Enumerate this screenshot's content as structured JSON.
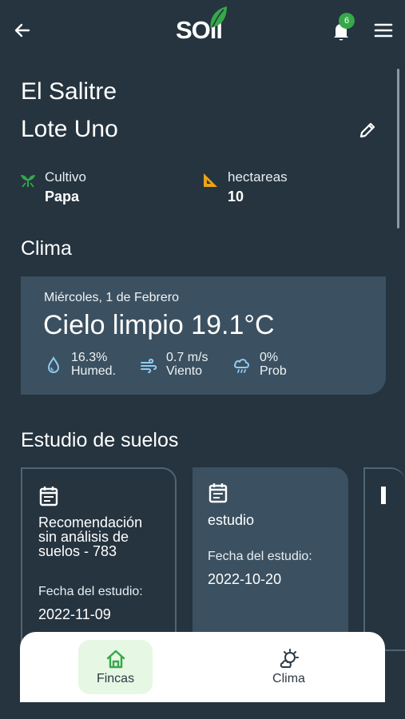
{
  "header": {
    "logo_text": "SOil",
    "notification_count": "6"
  },
  "farm": {
    "name": "El Salitre",
    "lot": "Lote Uno"
  },
  "stats": {
    "crop_label": "Cultivo",
    "crop_value": "Papa",
    "area_label": "hectareas",
    "area_value": "10"
  },
  "climate": {
    "section_title": "Clima",
    "date": "Miércoles, 1 de Febrero",
    "summary": "Cielo limpio 19.1°C",
    "humidity_value": "16.3%",
    "humidity_label": "Humed.",
    "wind_value": "0.7 m/s",
    "wind_label": "Viento",
    "rain_value": "0%",
    "rain_label": "Prob"
  },
  "soil_studies": {
    "section_title": "Estudio de suelos",
    "cards": [
      {
        "title_lines": [
          "Recomendación",
          "sin análisis de",
          "suelos - 783"
        ],
        "date_label": "Fecha del estudio:",
        "date": "2022-11-09"
      },
      {
        "title_lines": [
          "estudio"
        ],
        "date_label": "Fecha del estudio:",
        "date": "2022-10-20"
      }
    ]
  },
  "bottom_nav": {
    "items": [
      {
        "label": "Fincas",
        "active": true
      },
      {
        "label": "Clima",
        "active": false
      }
    ]
  },
  "colors": {
    "background": "#25343f",
    "card": "#3b5060",
    "accent_green": "#35a84a",
    "icon_blue": "#8ecbf0",
    "icon_orange": "#e8a317"
  }
}
